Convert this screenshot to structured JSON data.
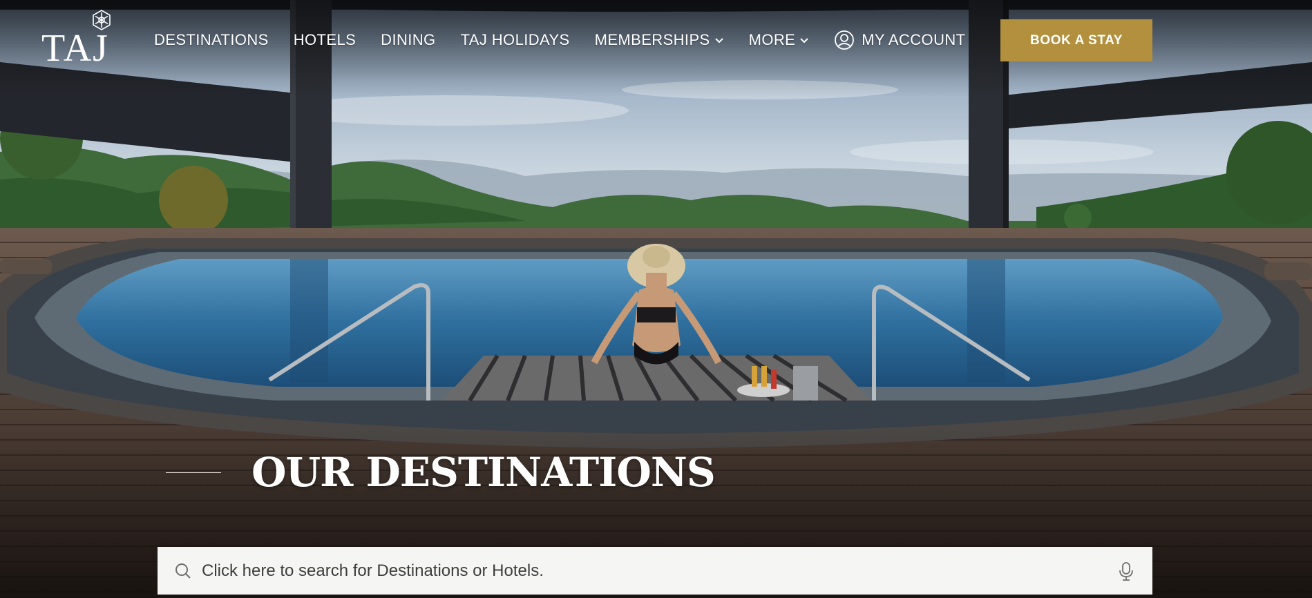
{
  "brand": {
    "logo_text": "TAJ",
    "emblem_icon": "taj-emblem-icon"
  },
  "nav": {
    "items": [
      {
        "label": "DESTINATIONS",
        "has_dropdown": false
      },
      {
        "label": "HOTELS",
        "has_dropdown": false
      },
      {
        "label": "DINING",
        "has_dropdown": false
      },
      {
        "label": "TAJ HOLIDAYS",
        "has_dropdown": false
      },
      {
        "label": "MEMBERSHIPS",
        "has_dropdown": true
      },
      {
        "label": "MORE",
        "has_dropdown": true
      }
    ],
    "account_label": "MY ACCOUNT",
    "account_icon": "user-circle-icon",
    "book_label": "BOOK A STAY"
  },
  "hero": {
    "image_description": "Infinity pool overlooking forested hills with a woman in a sun hat seated on a wooden deck",
    "section_title": "OUR DESTINATIONS"
  },
  "search": {
    "placeholder": "Click here to search for Destinations or Hotels.",
    "value": "",
    "search_icon": "search-icon",
    "mic_icon": "microphone-icon"
  },
  "colors": {
    "accent_gold": "#b3903d",
    "search_bg": "#f5f5f4",
    "text_light": "#ffffff"
  }
}
